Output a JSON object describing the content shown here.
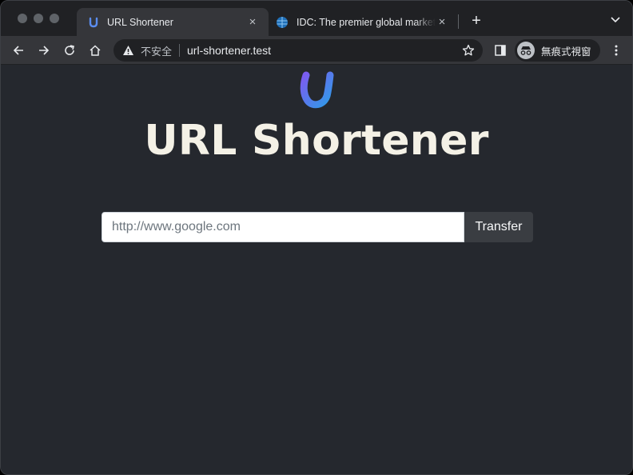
{
  "browser": {
    "tabs": [
      {
        "title": "URL Shortener",
        "active": true,
        "favicon": "u-logo-icon"
      },
      {
        "title": "IDC: The premier global market",
        "active": false,
        "favicon": "globe-icon"
      }
    ],
    "new_tab_symbol": "+",
    "close_symbol": "×",
    "address_bar": {
      "security_label": "不安全",
      "url": "url-shortener.test"
    },
    "incognito_label": "無痕式視窗"
  },
  "page": {
    "heading": "URL Shortener",
    "input": {
      "placeholder": "http://www.google.com",
      "value": ""
    },
    "submit_label": "Transfer"
  },
  "colors": {
    "page_background": "#25282e",
    "heading": "#f4f1e6",
    "button_background": "#3a3d42",
    "logo_gradient_start": "#7b5cf0",
    "logo_gradient_end": "#2f9be8"
  }
}
